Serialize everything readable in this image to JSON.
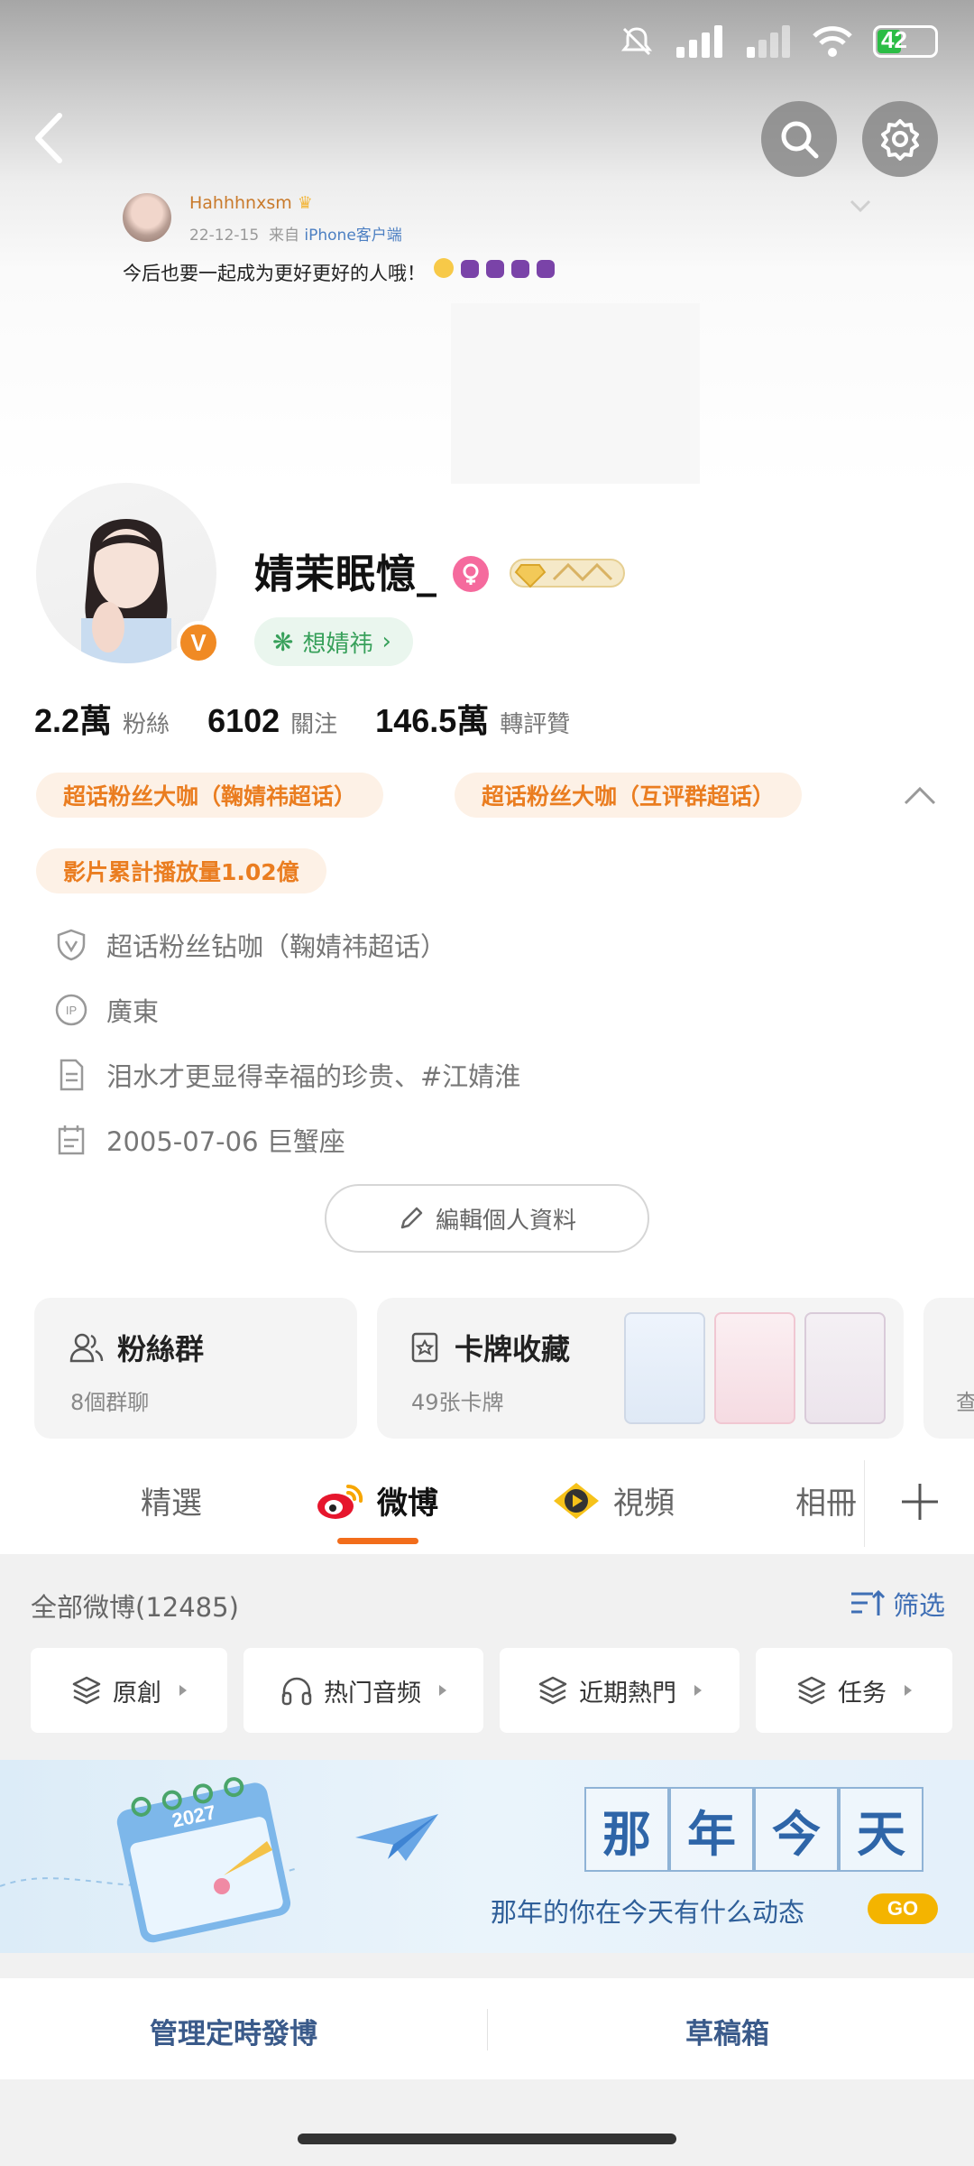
{
  "status_bar": {
    "battery": "42"
  },
  "embedded_post": {
    "author": "Hahhhnxsm",
    "date": "22-12-15",
    "source_prefix": "来自",
    "source": "iPhone客户端",
    "text": "今后也要一起成为更好更好的人哦！"
  },
  "profile": {
    "nickname": "婧茉眠憶_",
    "verified_mark": "V",
    "supertopic_pill": "想婧祎",
    "stats": [
      {
        "value": "2.2萬",
        "label": "粉絲"
      },
      {
        "value": "6102",
        "label": "關注"
      },
      {
        "value": "146.5萬",
        "label": "轉評贊"
      }
    ],
    "tags": [
      "超话粉丝大咖（鞠婧祎超话）",
      "超话粉丝大咖（互评群超话）",
      "影片累計播放量1.02億"
    ],
    "info": {
      "badge": "超话粉丝钻咖（鞠婧祎超话）",
      "ip": "廣東",
      "bio": "泪水才更显得幸福的珍贵、#江婧淮",
      "birthday": "2005-07-06 巨蟹座"
    },
    "edit_button": "編輯個人資料"
  },
  "cards": {
    "fans_group": {
      "title": "粉絲群",
      "sub": "8個群聊"
    },
    "card_collection": {
      "title": "卡牌收藏",
      "sub": "49张卡牌"
    },
    "third_partial": {
      "sub": "查"
    }
  },
  "tabs": [
    "精選",
    "微博",
    "視頻",
    "相冊"
  ],
  "feed": {
    "heading": "全部微博(12485)",
    "filter": "筛选",
    "chips": [
      "原創",
      "热门音频",
      "近期熱門",
      "任务"
    ]
  },
  "banner": {
    "year": "2027",
    "chars": [
      "那",
      "年",
      "今",
      "天"
    ],
    "subtitle": "那年的你在今天有什么动态",
    "go": "GO"
  },
  "bottom_actions": [
    "管理定時發博",
    "草稿箱"
  ],
  "colors": {
    "accent": "#f26d1b",
    "tag_text": "#ea7d20",
    "tag_bg": "#fdf1e6",
    "link_blue": "#3f6fb5"
  }
}
